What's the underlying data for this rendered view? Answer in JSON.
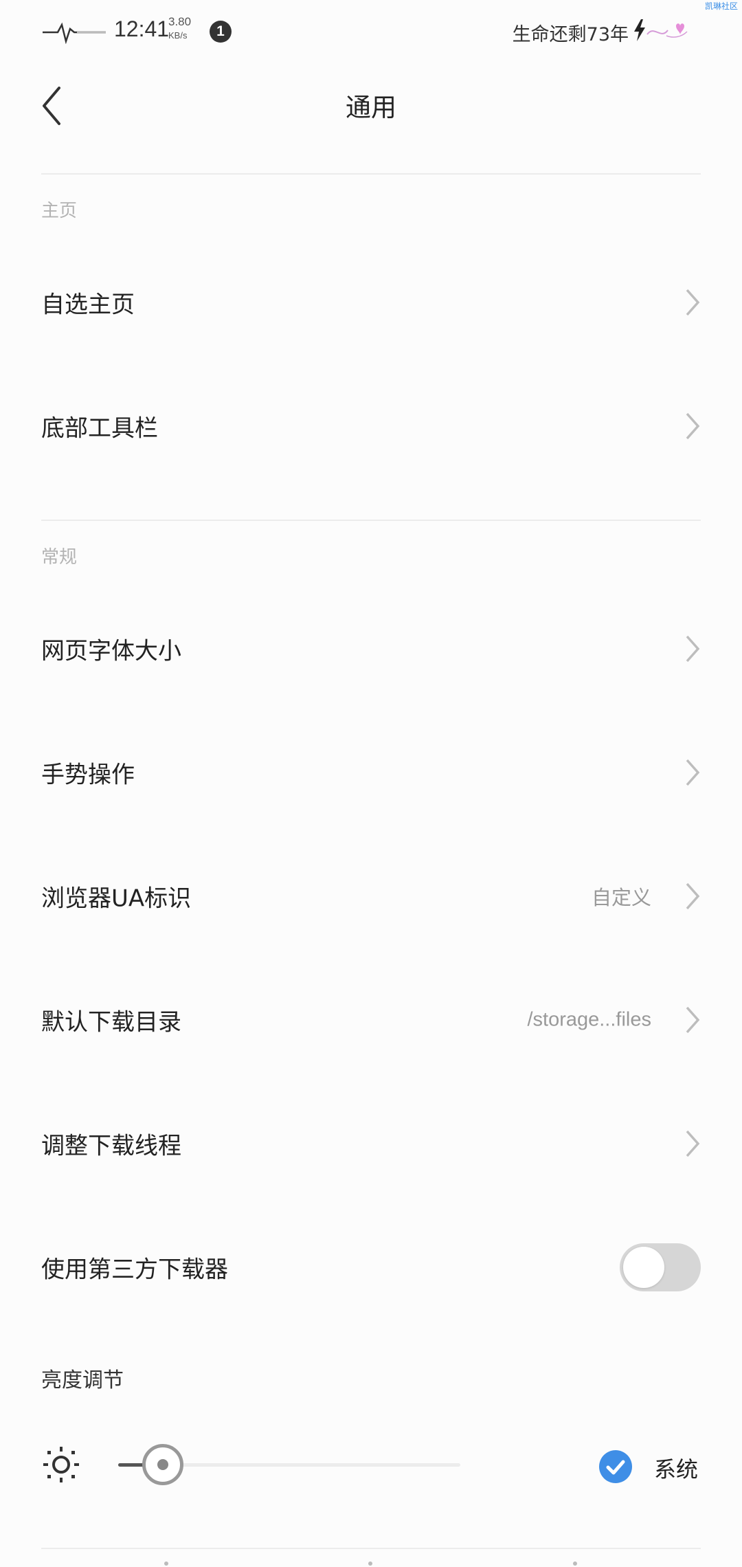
{
  "status_bar": {
    "time": "12:41",
    "net_speed_value": "3.80",
    "net_speed_unit": "KB/s",
    "notification_count": "1",
    "life_text": "生命还剩73年",
    "corner_text": "凯琳社区"
  },
  "header": {
    "title": "通用"
  },
  "sections": {
    "home": {
      "label": "主页",
      "items": [
        {
          "label": "自选主页"
        },
        {
          "label": "底部工具栏"
        }
      ]
    },
    "general": {
      "label": "常规",
      "items": [
        {
          "label": "网页字体大小",
          "value": ""
        },
        {
          "label": "手势操作",
          "value": ""
        },
        {
          "label": "浏览器UA标识",
          "value": "自定义"
        },
        {
          "label": "默认下载目录",
          "value": "/storage...files"
        },
        {
          "label": "调整下载线程",
          "value": ""
        }
      ],
      "third_party_downloader": {
        "label": "使用第三方下载器",
        "enabled": false
      }
    }
  },
  "brightness": {
    "label": "亮度调节",
    "level_percent": 13,
    "system_checked": true,
    "system_label": "系统"
  },
  "colors": {
    "accent": "#3f8ee6",
    "toggle_off": "#d6d6d6"
  }
}
